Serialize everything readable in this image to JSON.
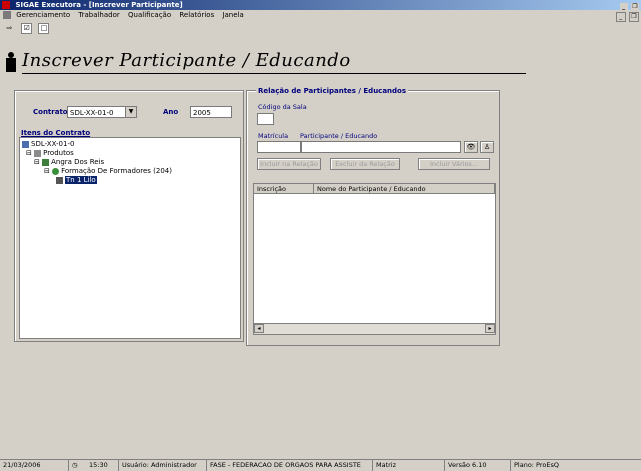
{
  "window": {
    "title": "SIGAE Executora - [Inscrever Participante]",
    "controls": [
      "_",
      "❐",
      "x"
    ]
  },
  "menu": {
    "items": [
      "Gerenciamento",
      "Trabalhador",
      "Qualificação",
      "Relatórios",
      "Janela"
    ],
    "mdi_controls": [
      "_",
      "❐"
    ]
  },
  "toolbar": {
    "check_label": "☑",
    "box_label": "□"
  },
  "header": {
    "title": "Inscrever Participante / Educando"
  },
  "contract": {
    "label": "Contrato",
    "value": "SDL-XX-01-0",
    "year_label": "Ano",
    "year_value": "2005"
  },
  "items": {
    "label": "Itens do Contrato",
    "tree": [
      {
        "text": "SDL-XX-01-0",
        "level": 0,
        "icon": "contract-icon"
      },
      {
        "text": "Produtos",
        "level": 1,
        "icon": "products-icon"
      },
      {
        "text": "Angra Dos Reis",
        "level": 2,
        "icon": "city-icon"
      },
      {
        "text": "Formação De Formadores (204)",
        "level": 3,
        "icon": "course-icon"
      },
      {
        "text": "Tn 1 Lilo",
        "level": 4,
        "icon": "class-icon",
        "selected": true
      }
    ]
  },
  "relation": {
    "title": "Relação de Participantes / Educandos",
    "room_label": "Código da Sala",
    "room_value": "",
    "matricula_label": "Matrícula",
    "participant_label": "Participante / Educando",
    "buttons": {
      "include": "Incluir na Relação",
      "exclude": "Excluir da Relação",
      "include_many": "Incluir Vários..."
    },
    "columns": [
      "Inscrição",
      "Nome do Participante / Educando"
    ]
  },
  "status": {
    "date": "21/03/2006",
    "time": "15:30",
    "user": "Usuário: Administrador",
    "org": "FASE - FEDERACAO DE ORGAOS PARA ASSISTE",
    "unit": "Matriz",
    "version": "Versão 6.10",
    "plan": "Plano: ProEsQ"
  }
}
